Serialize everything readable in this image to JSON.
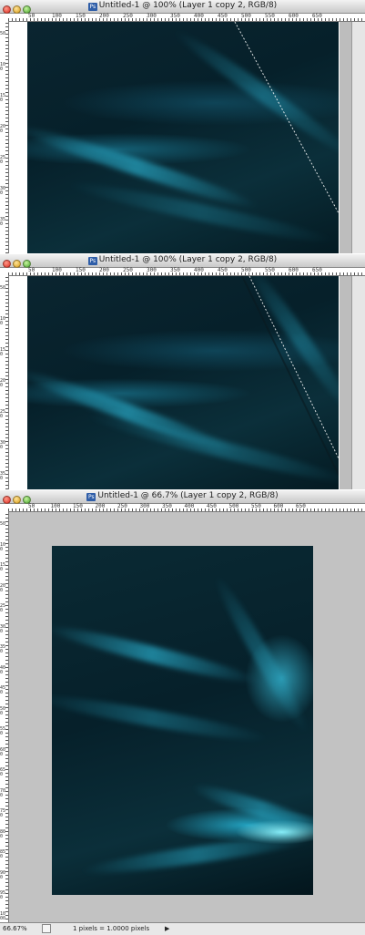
{
  "windows": [
    {
      "title": "Untitled-1 @ 100% (Layer 1 copy 2, RGB/8)",
      "ruler_top_labels": [
        "50",
        "100",
        "150",
        "200",
        "250",
        "300",
        "350",
        "400",
        "450",
        "500",
        "550",
        "600",
        "650"
      ],
      "ruler_left_labels": [
        "50",
        "100",
        "150",
        "200",
        "250",
        "300",
        "350"
      ]
    },
    {
      "title": "Untitled-1 @ 100% (Layer 1 copy 2, RGB/8)",
      "ruler_top_labels": [
        "50",
        "100",
        "150",
        "200",
        "250",
        "300",
        "350",
        "400",
        "450",
        "500",
        "550",
        "600",
        "650"
      ],
      "ruler_left_labels": [
        "50",
        "100",
        "150",
        "200",
        "250",
        "300",
        "350"
      ]
    },
    {
      "title": "Untitled-1 @ 66.7% (Layer 1 copy 2, RGB/8)",
      "ruler_top_labels": [
        "50",
        "100",
        "150",
        "200",
        "250",
        "300",
        "350",
        "400",
        "450",
        "500",
        "550",
        "600",
        "650"
      ],
      "ruler_left_labels": [
        "50",
        "100",
        "150",
        "200",
        "250",
        "300",
        "350",
        "400",
        "450",
        "500",
        "550",
        "600",
        "650",
        "700",
        "750",
        "800",
        "850",
        "900",
        "950",
        "1000"
      ],
      "status": {
        "zoom": "66.67%",
        "info": "1 pixels = 1.0000 pixels"
      }
    }
  ],
  "colors": {
    "canvas_dark": "#06202a",
    "streak": "#2aaed0",
    "highlight": "#7ff0ff",
    "pasteboard": "#c2c2c2"
  }
}
